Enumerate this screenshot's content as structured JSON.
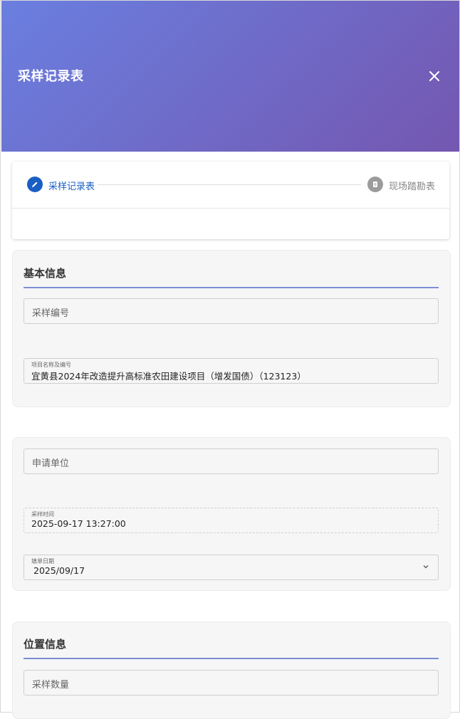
{
  "header": {
    "title": "采样记录表",
    "close_icon": "close-icon"
  },
  "stepper": {
    "steps": [
      {
        "label": "采样记录表",
        "icon": "pencil-icon",
        "state": "active"
      },
      {
        "label": "现场踏勘表",
        "icon": "clipboard-icon",
        "state": "inactive"
      }
    ]
  },
  "basic_info": {
    "title": "基本信息",
    "sample_no_placeholder": "采样编号",
    "project_label": "项目名称及编号",
    "project_value": "宜黄县2024年改造提升高标准农田建设项目（增发国债）（123123）"
  },
  "applicant_section": {
    "applicant_placeholder": "申请单位",
    "sample_time_label": "采样时间",
    "sample_time_value": "2025-09-17 13:27:00",
    "fill_date_label": "填单日期",
    "fill_date_value": "2025/09/17"
  },
  "location_info": {
    "title": "位置信息",
    "sample_qty_placeholder": "采样数量"
  },
  "colors": {
    "accent": "#1a5fc4",
    "header_start": "#6a7fe0",
    "header_end": "#7457b0"
  }
}
